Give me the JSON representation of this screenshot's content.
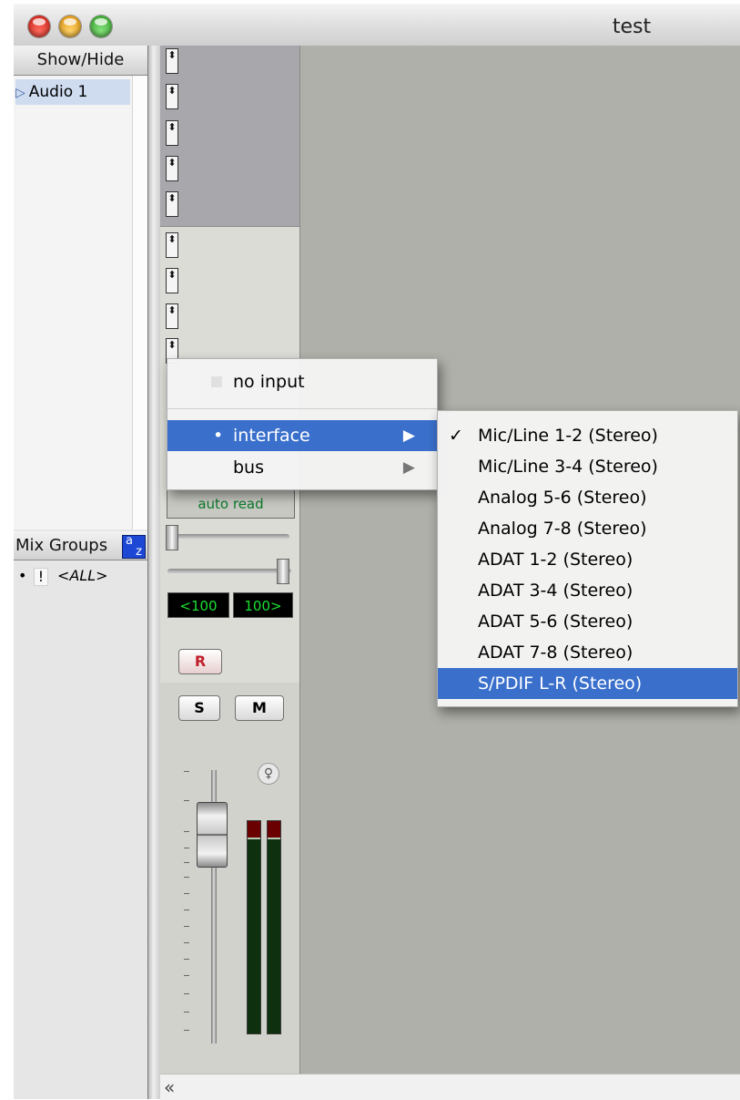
{
  "window": {
    "title": "test"
  },
  "left_panel": {
    "show_hide_title": "Show/Hide",
    "tracks": [
      {
        "name": "Audio 1"
      }
    ],
    "mix_groups_title": "Mix Groups",
    "sort_badge": "az",
    "groups": [
      {
        "bullet": "•",
        "flag": "!",
        "name": "<ALL>"
      }
    ]
  },
  "strip": {
    "automation": "auto read",
    "pan_left": "<100",
    "pan_right": "100>",
    "record": "R",
    "solo": "S",
    "mute": "M",
    "insert_glyph": "⬍"
  },
  "input_menu": {
    "items": [
      {
        "label": "no input",
        "has_submenu": false,
        "selected": false
      },
      {
        "label": "interface",
        "has_submenu": true,
        "selected": true
      },
      {
        "label": "bus",
        "has_submenu": true,
        "selected": false
      }
    ],
    "submenu_arrow": "▶",
    "selected_marker": "•"
  },
  "interface_submenu": {
    "checkmark": "✓",
    "items": [
      {
        "label": "Mic/Line 1-2 (Stereo)",
        "checked": true,
        "highlighted": false
      },
      {
        "label": "Mic/Line 3-4 (Stereo)",
        "checked": false,
        "highlighted": false
      },
      {
        "label": "Analog 5-6 (Stereo)",
        "checked": false,
        "highlighted": false
      },
      {
        "label": "Analog 7-8 (Stereo)",
        "checked": false,
        "highlighted": false
      },
      {
        "label": "ADAT 1-2 (Stereo)",
        "checked": false,
        "highlighted": false
      },
      {
        "label": "ADAT 3-4 (Stereo)",
        "checked": false,
        "highlighted": false
      },
      {
        "label": "ADAT 5-6 (Stereo)",
        "checked": false,
        "highlighted": false
      },
      {
        "label": "ADAT 7-8 (Stereo)",
        "checked": false,
        "highlighted": false
      },
      {
        "label": "S/PDIF L-R (Stereo)",
        "checked": false,
        "highlighted": true
      }
    ]
  },
  "bottom_bar": {
    "collapse": "«"
  },
  "colors": {
    "highlight": "#3a70cc",
    "meter_green": "#19e031",
    "record_red": "#c0202a",
    "automation_green": "#0a7a2a"
  }
}
